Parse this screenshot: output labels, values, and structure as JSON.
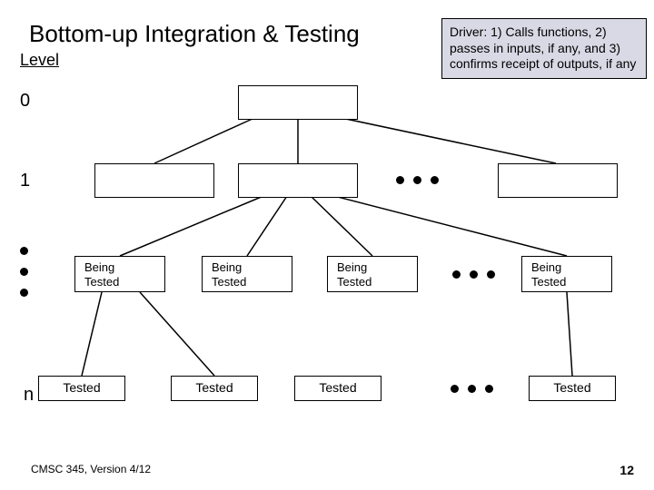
{
  "title": "Bottom-up Integration & Testing",
  "level_label": "Level",
  "callout_text": "Driver: 1) Calls functions, 2) passes in inputs, if any, and 3) confirms receipt of outputs, if any",
  "levels": {
    "l0": "0",
    "l1": "1",
    "ln": "n"
  },
  "being_tested": {
    "line1": "Being",
    "line2": "Tested",
    "items": [
      "Being Tested",
      "Being Tested",
      "Being Tested",
      "Being Tested"
    ]
  },
  "tested": {
    "label": "Tested",
    "items": [
      "Tested",
      "Tested",
      "Tested",
      "Tested"
    ]
  },
  "chart_data": {
    "type": "table",
    "description": "Bottom-up integration tree diagram. Lower-level modules are tested first using drivers for the modules above.",
    "levels": [
      {
        "level": "0",
        "boxes": [
          {
            "state": "empty"
          }
        ]
      },
      {
        "level": "1",
        "boxes": [
          {
            "state": "empty"
          },
          {
            "state": "empty"
          },
          {
            "state": "ellipsis"
          },
          {
            "state": "empty"
          }
        ]
      },
      {
        "level": "…",
        "boxes": [
          {
            "state": "Being Tested"
          },
          {
            "state": "Being Tested"
          },
          {
            "state": "Being Tested"
          },
          {
            "state": "ellipsis"
          },
          {
            "state": "Being Tested"
          }
        ]
      },
      {
        "level": "n",
        "boxes": [
          {
            "state": "Tested"
          },
          {
            "state": "Tested"
          },
          {
            "state": "Tested"
          },
          {
            "state": "ellipsis"
          },
          {
            "state": "Tested"
          }
        ]
      }
    ],
    "edges": [
      [
        "0.0",
        "1.0"
      ],
      [
        "0.0",
        "1.1"
      ],
      [
        "0.0",
        "1.3"
      ],
      [
        "1.1",
        "bt.0"
      ],
      [
        "1.1",
        "bt.1"
      ],
      [
        "1.1",
        "bt.2"
      ],
      [
        "1.1",
        "bt.3"
      ],
      [
        "bt.0",
        "n.0"
      ],
      [
        "bt.0",
        "n.1"
      ],
      [
        "bt.3",
        "n.3"
      ]
    ],
    "callout": "Driver: 1) Calls functions, 2) passes in inputs, if any, and 3) confirms receipt of outputs, if any"
  },
  "footer": {
    "left": "CMSC 345, Version 4/12",
    "right": "12"
  }
}
